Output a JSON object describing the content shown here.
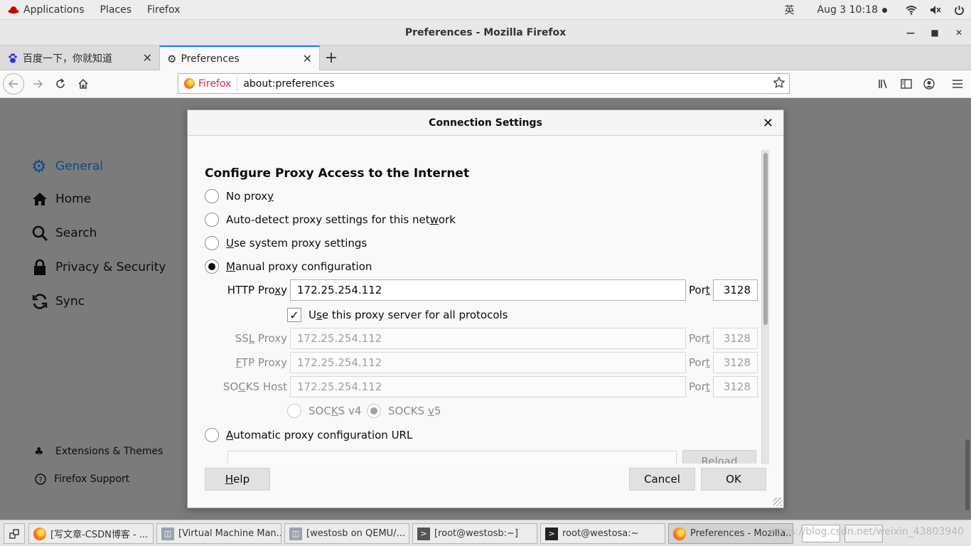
{
  "topbar": {
    "applications": "Applications",
    "places": "Places",
    "firefox": "Firefox",
    "input_method": "英",
    "datetime": "Aug 3  10:18"
  },
  "window": {
    "title": "Preferences - Mozilla Firefox"
  },
  "tabs": [
    {
      "label": "百度一下，你就知道",
      "icon": "baidu-paw-icon"
    },
    {
      "label": "Preferences",
      "icon": "gear-icon"
    }
  ],
  "navbar": {
    "identity_label": "Firefox",
    "url": "about:preferences"
  },
  "sidebar": {
    "items": [
      {
        "label": "General",
        "icon": "gear-icon"
      },
      {
        "label": "Home",
        "icon": "home-icon"
      },
      {
        "label": "Search",
        "icon": "search-icon"
      },
      {
        "label": "Privacy & Security",
        "icon": "lock-icon"
      },
      {
        "label": "Sync",
        "icon": "sync-icon"
      }
    ],
    "footer": [
      {
        "label": "Extensions & Themes",
        "icon": "puzzle-icon"
      },
      {
        "label": "Firefox Support",
        "icon": "help-icon"
      }
    ]
  },
  "dialog": {
    "title": "Connection Settings",
    "heading": "Configure Proxy Access to the Internet",
    "options": {
      "no_proxy": {
        "pre": "No prox",
        "ul": "y",
        "post": ""
      },
      "auto_detect": {
        "pre": "Auto-detect proxy settings for this net",
        "ul": "w",
        "post": "ork"
      },
      "system": {
        "pre": "",
        "ul": "U",
        "post": "se system proxy settings"
      },
      "manual": {
        "pre": "",
        "ul": "M",
        "post": "anual proxy configuration"
      },
      "auto_url": {
        "pre": "",
        "ul": "A",
        "post": "utomatic proxy configuration URL"
      }
    },
    "selected": "manual",
    "http": {
      "label_pre": "HTTP Pro",
      "label_ul": "x",
      "label_post": "y",
      "value": "172.25.254.112",
      "port": "3128"
    },
    "share": {
      "pre": "U",
      "ul": "s",
      "post": "e this proxy server for all protocols",
      "checked": true
    },
    "ssl": {
      "label_pre": "SS",
      "label_ul": "L",
      "label_post": " Proxy",
      "value": "172.25.254.112",
      "port": "3128"
    },
    "ftp": {
      "label_pre": "",
      "label_ul": "F",
      "label_post": "TP Proxy",
      "value": "172.25.254.112",
      "port": "3128"
    },
    "socks": {
      "label_pre": "SO",
      "label_ul": "C",
      "label_post": "KS Host",
      "value": "172.25.254.112",
      "port": "3128"
    },
    "port_label": {
      "pre": "Por",
      "ul": "t"
    },
    "socks_v4": {
      "pre": "SOC",
      "ul": "K",
      "post": "S v4"
    },
    "socks_v5": {
      "pre": "SOCKS ",
      "ul": "v",
      "post": "5"
    },
    "reload": "Reload",
    "help": {
      "ul": "H",
      "post": "elp"
    },
    "cancel": "Cancel",
    "ok": "OK"
  },
  "taskbar": {
    "items": [
      {
        "label": "[写文章-CSDN博客 - ...",
        "icon": "firefox-icon"
      },
      {
        "label": "[Virtual Machine Man...",
        "icon": "virt-manager-icon"
      },
      {
        "label": "[westosb on QEMU/...",
        "icon": "virt-manager-icon"
      },
      {
        "label": "[root@westosb:~]",
        "icon": "terminal-icon"
      },
      {
        "label": "root@westosa:~",
        "icon": "terminal-icon"
      },
      {
        "label": "Preferences - Mozilla...",
        "icon": "firefox-icon"
      }
    ],
    "watermark": "https://blog.csdn.net/weixin_43803940"
  },
  "colors": {
    "accent": "#0a84ff",
    "selected_category": "#0a4a8c"
  }
}
